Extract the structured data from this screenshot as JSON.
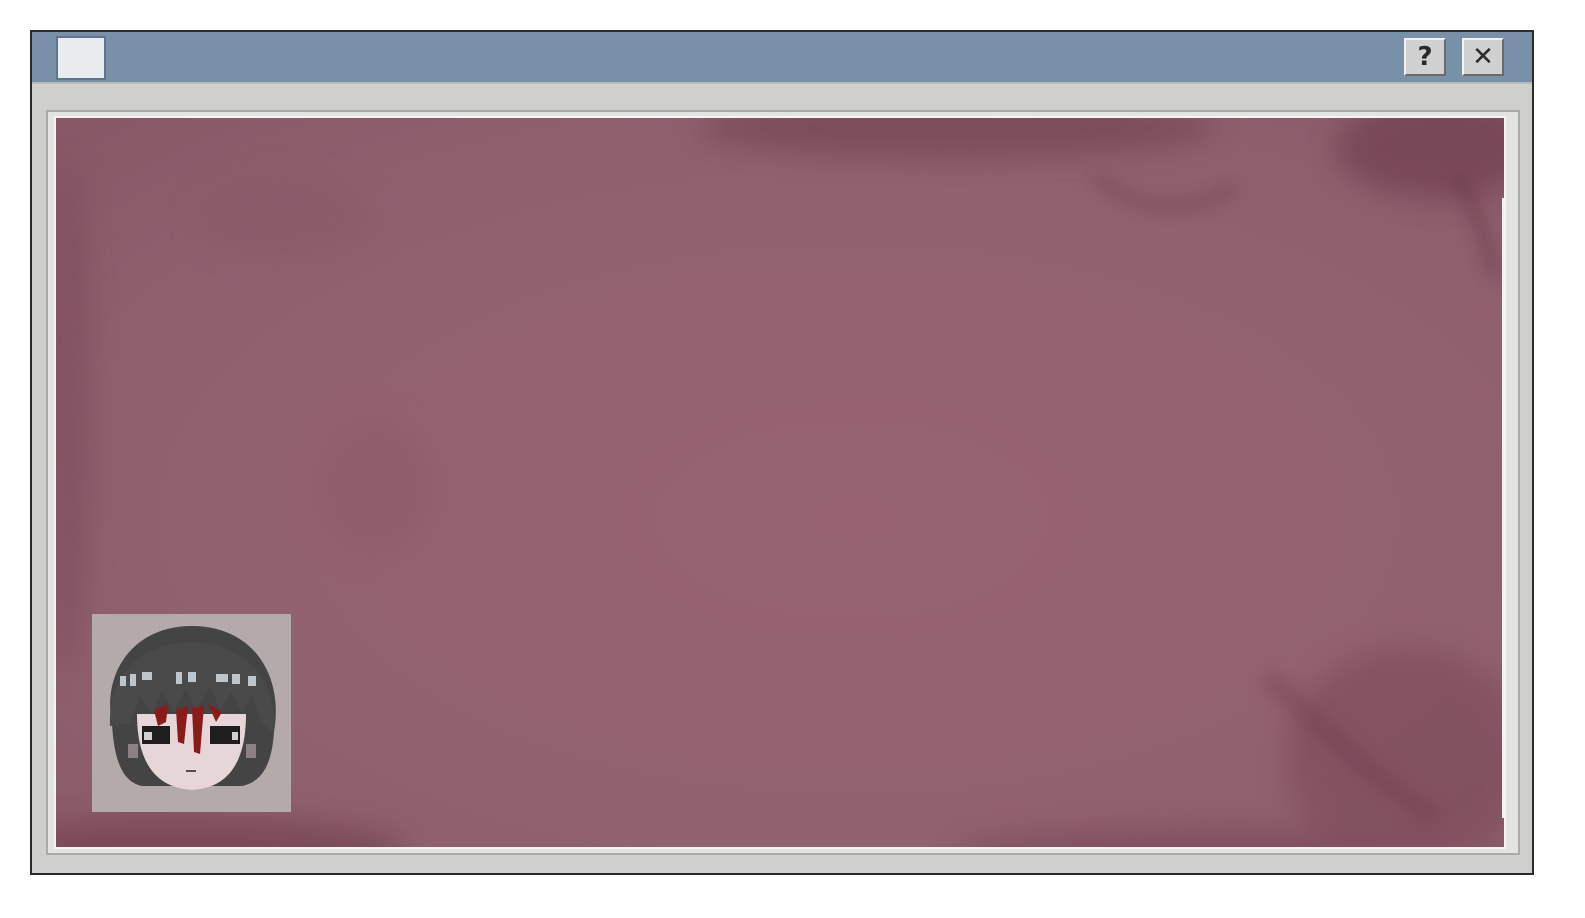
{
  "window": {
    "title": "",
    "help_label": "?",
    "close_label": "✕"
  },
  "icons": {
    "help": "question-mark-icon",
    "close": "close-icon"
  },
  "colors": {
    "titlebar": "#7890a8",
    "frame": "#cfd0cd",
    "scene_background": "#946270",
    "portrait_background": "#b4aaaa",
    "hair": "#3f3f3f",
    "blood": "#8b1a1a"
  },
  "scene": {
    "portrait": "character-face-portrait"
  }
}
